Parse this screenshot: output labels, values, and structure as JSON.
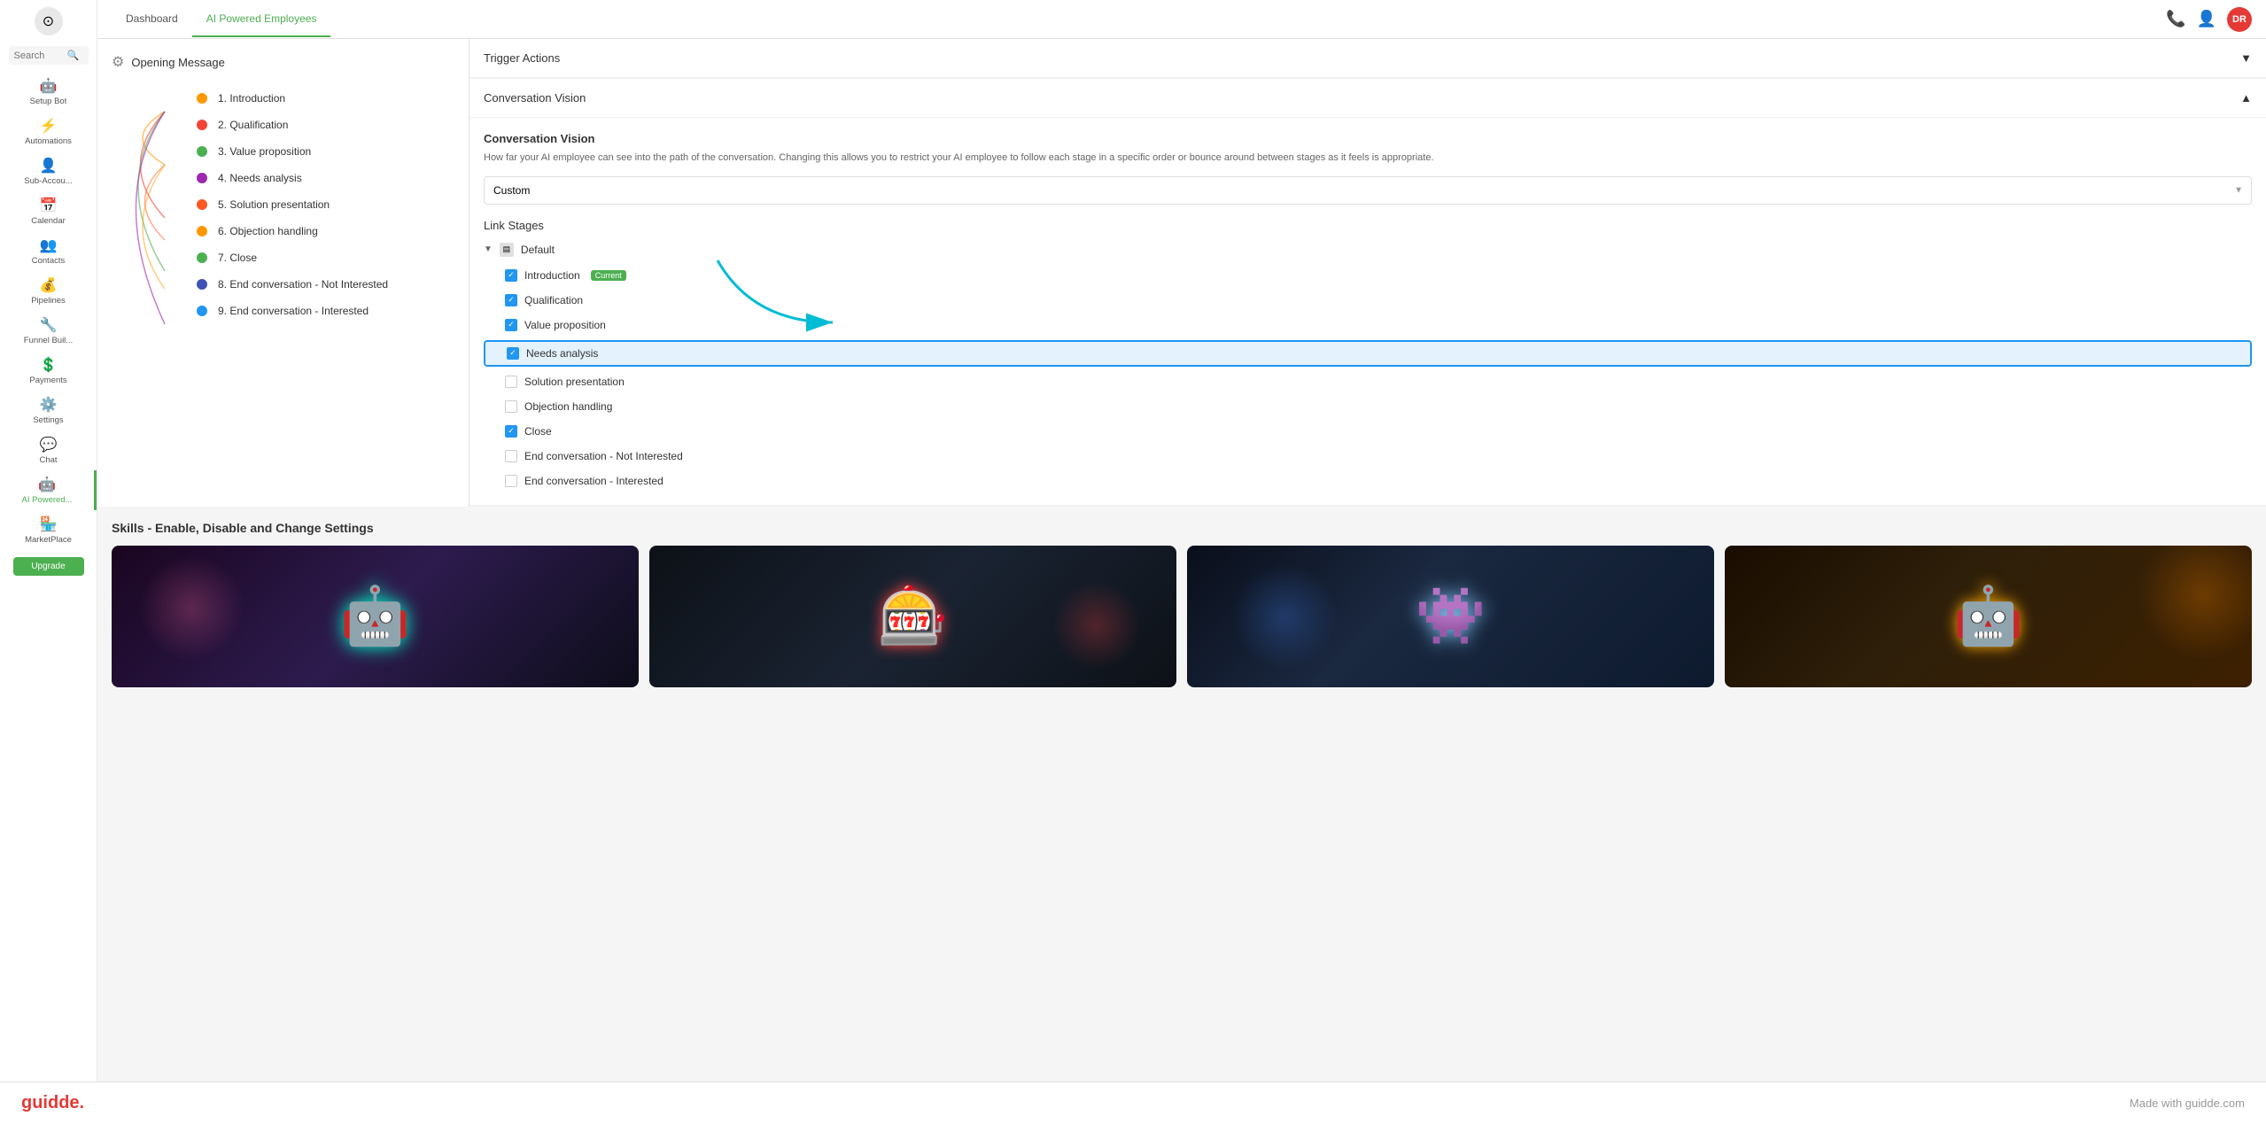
{
  "app": {
    "title": "AI Powered Employees"
  },
  "footer": {
    "logo": "guidde.",
    "tagline": "Made with guidde.com"
  },
  "sidebar": {
    "search_placeholder": "Search",
    "items": [
      {
        "id": "setup-bot",
        "label": "Setup Bot",
        "icon": "🤖"
      },
      {
        "id": "automations",
        "label": "Automations",
        "icon": "⚡"
      },
      {
        "id": "sub-accounts",
        "label": "Sub-Accou...",
        "icon": "👤"
      },
      {
        "id": "calendar",
        "label": "Calendar",
        "icon": "📅"
      },
      {
        "id": "contacts",
        "label": "Contacts",
        "icon": "👥"
      },
      {
        "id": "pipelines",
        "label": "Pipelines",
        "icon": "💰"
      },
      {
        "id": "funnel-builder",
        "label": "Funnel Buil...",
        "icon": "🔧"
      },
      {
        "id": "payments",
        "label": "Payments",
        "icon": "💲"
      },
      {
        "id": "settings",
        "label": "Settings",
        "icon": "⚙️"
      },
      {
        "id": "chat",
        "label": "Chat",
        "icon": "💬"
      },
      {
        "id": "ai-powered",
        "label": "AI Powered...",
        "icon": "🤖",
        "active": true
      },
      {
        "id": "marketplace",
        "label": "MarketPlace",
        "icon": "🏪"
      }
    ],
    "cta_label": "Upgrade"
  },
  "top_nav": {
    "tabs": [
      {
        "id": "dashboard",
        "label": "Dashboard",
        "active": false
      },
      {
        "id": "ai-powered-employees",
        "label": "AI Powered Employees",
        "active": true
      }
    ],
    "avatar_initials": "DR"
  },
  "flow": {
    "title": "Opening Message",
    "stages": [
      {
        "id": "intro",
        "label": "1. Introduction",
        "color": "#FF9800"
      },
      {
        "id": "qual",
        "label": "2. Qualification",
        "color": "#f44336"
      },
      {
        "id": "value",
        "label": "3. Value proposition",
        "color": "#4CAF50"
      },
      {
        "id": "needs",
        "label": "4. Needs analysis",
        "color": "#9C27B0"
      },
      {
        "id": "solution",
        "label": "5. Solution presentation",
        "color": "#FF5722"
      },
      {
        "id": "objection",
        "label": "6. Objection handling",
        "color": "#FF9800"
      },
      {
        "id": "close",
        "label": "7. Close",
        "color": "#4CAF50"
      },
      {
        "id": "end-not-interested",
        "label": "8. End conversation - Not Interested",
        "color": "#3F51B5"
      },
      {
        "id": "end-interested",
        "label": "9. End conversation - Interested",
        "color": "#2196F3"
      }
    ]
  },
  "trigger_actions": {
    "title": "Trigger Actions",
    "collapsed": true
  },
  "conversation_vision": {
    "section_title": "Conversation Vision",
    "title": "Conversation Vision",
    "description": "How far your AI employee can see into the path of the conversation. Changing this allows you to restrict your AI employee to follow each stage in a specific order or bounce around between stages as it feels is appropriate.",
    "select_value": "Custom",
    "link_stages_title": "Link Stages",
    "default_label": "Default",
    "stages": [
      {
        "id": "introduction",
        "label": "Introduction",
        "checked": true,
        "current": true
      },
      {
        "id": "qualification",
        "label": "Qualification",
        "checked": true
      },
      {
        "id": "value-prop",
        "label": "Value proposition",
        "checked": true
      },
      {
        "id": "needs-analysis",
        "label": "Needs analysis",
        "checked": true,
        "highlighted": true
      },
      {
        "id": "solution-pres",
        "label": "Solution presentation",
        "checked": false
      },
      {
        "id": "objection-handling",
        "label": "Objection handling",
        "checked": false
      },
      {
        "id": "close",
        "label": "Close",
        "checked": true
      },
      {
        "id": "end-not-interested",
        "label": "End conversation - Not Interested",
        "checked": false
      },
      {
        "id": "end-interested",
        "label": "End conversation - Interested",
        "checked": false
      }
    ]
  },
  "skills": {
    "title": "Skills - Enable, Disable and Change Settings",
    "cards": [
      {
        "id": "skill-1",
        "bg": "#1a0a2e"
      },
      {
        "id": "skill-2",
        "bg": "#0d1b2a"
      },
      {
        "id": "skill-3",
        "bg": "#0a1628"
      },
      {
        "id": "skill-4",
        "bg": "#2a1500"
      }
    ]
  }
}
